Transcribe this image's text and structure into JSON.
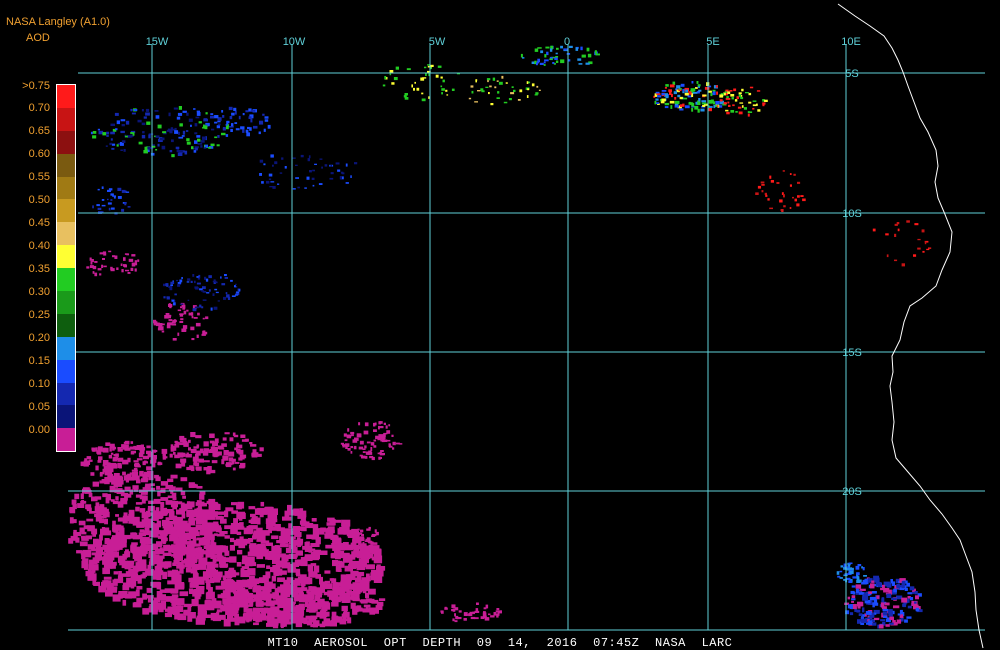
{
  "header": {
    "title": "NASA Langley (A1.0)",
    "variable": "AOD"
  },
  "legend": {
    "labels": [
      ">0.75",
      "0.70",
      "0.65",
      "0.60",
      "0.55",
      "0.50",
      "0.45",
      "0.40",
      "0.35",
      "0.30",
      "0.25",
      "0.20",
      "0.15",
      "0.10",
      "0.05",
      "0.00"
    ],
    "colors": [
      "#ff1a1a",
      "#c81414",
      "#8c1010",
      "#7a5a10",
      "#a07a14",
      "#c89a20",
      "#e8c060",
      "#ffff33",
      "#22cc22",
      "#1a9a1a",
      "#0e5e0e",
      "#1e8ee8",
      "#1a4cff",
      "#1428b0",
      "#0a1478",
      "#c81e96"
    ]
  },
  "map": {
    "lon_labels": [
      "15W",
      "10W",
      "5W",
      "0",
      "5E",
      "10E"
    ],
    "lat_labels": [
      "5S",
      "10S",
      "15S",
      "20S"
    ],
    "grid_color": "#5fd0d8",
    "coast_color": "#ffffff",
    "aod_low_color": "#c81e96"
  },
  "footer": {
    "text": "MT10  AEROSOL OPT DEPTH   09 14, 2016 07:45Z   NASA LARC"
  }
}
